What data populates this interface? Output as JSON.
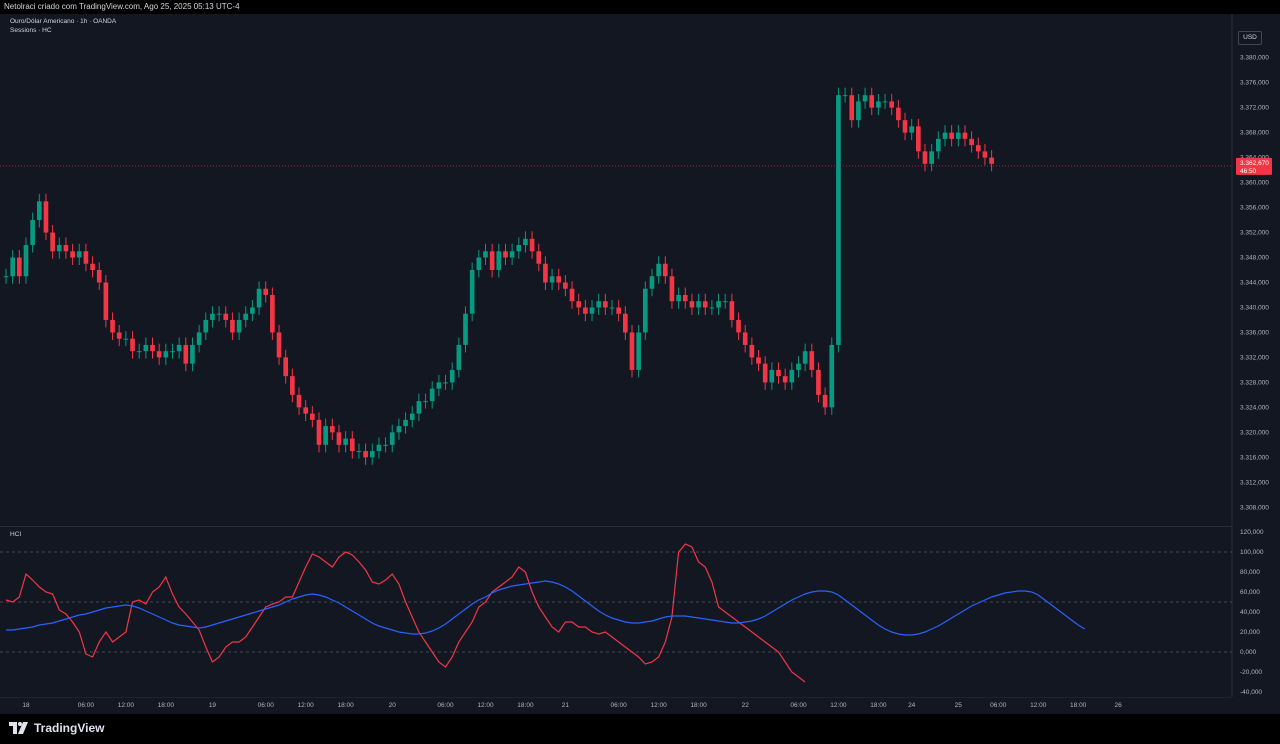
{
  "header": {
    "caption": "Netolraci criado com TradingView.com, Ago 25, 2025 05:13 UTC-4"
  },
  "legend": {
    "symbol": "Ouro/Dólar Americano · 1h · OANDA",
    "indicator": "Sessions · HC",
    "pane2_title": "HCI"
  },
  "currency_button": "USD",
  "current_price": {
    "value": "3.362,670",
    "countdown": "46:50",
    "color": "#f23645"
  },
  "colors": {
    "up": "#089981",
    "down": "#f23645",
    "background": "#131722",
    "line_blue": "#2962ff",
    "line_red": "#f23645",
    "line_green": "#4caf50",
    "line_purple": "#9c27b0"
  },
  "footer": {
    "brand": "TradingView"
  },
  "chart_data": [
    {
      "type": "candlestick",
      "title": "Ouro/Dólar Americano · 1h · OANDA",
      "ylim": [
        3305,
        3387
      ],
      "y_ticks": [
        "3.380,000",
        "3.376,000",
        "3.372,000",
        "3.368,000",
        "3.364,000",
        "3.360,000",
        "3.356,000",
        "3.352,000",
        "3.348,000",
        "3.344,000",
        "3.340,000",
        "3.336,000",
        "3.332,000",
        "3.328,000",
        "3.324,000",
        "3.320,000",
        "3.316,000",
        "3.312,000",
        "3.308,000"
      ],
      "y_tick_values": [
        3380,
        3376,
        3372,
        3368,
        3364,
        3360,
        3356,
        3352,
        3348,
        3344,
        3340,
        3336,
        3332,
        3328,
        3324,
        3320,
        3316,
        3312,
        3308
      ],
      "x_ticks": [
        "18",
        "06:00",
        "12:00",
        "18:00",
        "19",
        "06:00",
        "12:00",
        "18:00",
        "20",
        "06:00",
        "12:00",
        "18:00",
        "21",
        "06:00",
        "12:00",
        "18:00",
        "22",
        "06:00",
        "12:00",
        "18:00",
        "24",
        "25",
        "06:00",
        "12:00",
        "18:00",
        "26"
      ],
      "x_tick_index": [
        3,
        12,
        18,
        24,
        31,
        39,
        45,
        51,
        58,
        66,
        72,
        78,
        84,
        92,
        98,
        104,
        111,
        119,
        125,
        131,
        136,
        143,
        149,
        155,
        161,
        167
      ],
      "closes": [
        3345,
        3348,
        3345,
        3350,
        3354,
        3357,
        3352,
        3349,
        3350,
        3349,
        3348,
        3349,
        3347,
        3346,
        3344,
        3338,
        3336,
        3335,
        3335,
        3333,
        3333,
        3334,
        3333,
        3332,
        3333,
        3333,
        3334,
        3331,
        3334,
        3336,
        3338,
        3339,
        3339,
        3338,
        3336,
        3338,
        3339,
        3340,
        3343,
        3342,
        3336,
        3332,
        3329,
        3326,
        3324,
        3323,
        3322,
        3318,
        3321,
        3320,
        3318,
        3319,
        3317,
        3317,
        3316,
        3317,
        3318,
        3318,
        3320,
        3321,
        3322,
        3323,
        3325,
        3325,
        3327,
        3328,
        3328,
        3330,
        3334,
        3339,
        3346,
        3348,
        3349,
        3346,
        3349,
        3348,
        3349,
        3350,
        3351,
        3349,
        3347,
        3344,
        3345,
        3344,
        3343,
        3341,
        3340,
        3339,
        3340,
        3341,
        3340,
        3340,
        3339,
        3336,
        3330,
        3336,
        3343,
        3345,
        3347,
        3345,
        3341,
        3342,
        3341,
        3340,
        3341,
        3340,
        3340,
        3341,
        3341,
        3338,
        3336,
        3334,
        3332,
        3331,
        3328,
        3330,
        3329,
        3328,
        3330,
        3331,
        3333,
        3330,
        3326,
        3324,
        3334,
        3374,
        3374,
        3370,
        3373,
        3374,
        3372,
        3373,
        3373,
        3372,
        3370,
        3368,
        3369,
        3365,
        3363,
        3365,
        3367,
        3368,
        3367,
        3368,
        3367,
        3366,
        3365,
        3364,
        3363
      ]
    },
    {
      "type": "line",
      "title": "HCI",
      "ylim": [
        -45,
        125
      ],
      "y_ticks": [
        "120,000",
        "100,000",
        "80,000",
        "60,000",
        "40,000",
        "20,000",
        "0,000",
        "-20,000",
        "-40,000"
      ],
      "y_tick_values": [
        120,
        100,
        80,
        60,
        40,
        20,
        0,
        -20,
        -40
      ],
      "levels": [
        100,
        50,
        0
      ],
      "series": [
        {
          "values": [
            52,
            50,
            55,
            78,
            72,
            65,
            60,
            58,
            42,
            38,
            30,
            20,
            -2,
            -5,
            10,
            20,
            10,
            15,
            20,
            50,
            52,
            48,
            60,
            65,
            75,
            58,
            45,
            38,
            30,
            22,
            5,
            -10,
            -5,
            5,
            10,
            10,
            15,
            25,
            35,
            45,
            48,
            50,
            55,
            55,
            70,
            85,
            98,
            95,
            90,
            85,
            95,
            100,
            97,
            90,
            82,
            70,
            68,
            72,
            78,
            68,
            50,
            35,
            20,
            10,
            0,
            -10,
            -15,
            -5,
            10,
            20,
            30,
            45,
            50,
            60,
            65,
            70,
            75,
            85,
            80,
            60,
            45,
            35,
            25,
            20,
            30,
            30,
            25,
            25,
            20,
            18,
            20,
            15,
            10,
            5,
            0,
            -5,
            -12,
            -10,
            -5,
            10,
            35,
            100,
            108,
            105,
            90,
            85,
            70,
            45,
            40,
            35,
            30,
            25,
            20,
            15,
            10,
            5,
            0,
            -10,
            -20,
            -25,
            -30
          ]
        },
        {
          "values": [
            22,
            22,
            23,
            24,
            25,
            27,
            28,
            29,
            31,
            33,
            35,
            37,
            38,
            40,
            42,
            44,
            45,
            46,
            47,
            46,
            44,
            41,
            38,
            35,
            32,
            29,
            27,
            26,
            25,
            24,
            25,
            27,
            29,
            31,
            33,
            35,
            37,
            39,
            41,
            43,
            45,
            47,
            50,
            53,
            55,
            57,
            58,
            57,
            55,
            52,
            49,
            45,
            41,
            37,
            33,
            29,
            26,
            24,
            22,
            20,
            19,
            18,
            18,
            19,
            21,
            24,
            28,
            33,
            38,
            43,
            48,
            52,
            55,
            59,
            62,
            64,
            66,
            67,
            68,
            69,
            70,
            71,
            70,
            68,
            65,
            61,
            56,
            51,
            46,
            41,
            37,
            34,
            32,
            30,
            29,
            29,
            30,
            31,
            33,
            35,
            36,
            36,
            36,
            35,
            34,
            33,
            32,
            31,
            30,
            29,
            29,
            30,
            31,
            33,
            36,
            40,
            44,
            48,
            52,
            55,
            58,
            60,
            61,
            61,
            60,
            57,
            52,
            47,
            42,
            37,
            32,
            27,
            23,
            20,
            18,
            17,
            17,
            18,
            20,
            23,
            26,
            30,
            34,
            38,
            42,
            46,
            49,
            52,
            55,
            57,
            59,
            60,
            61,
            61,
            60,
            57,
            52,
            47,
            42,
            37,
            32,
            27,
            23
          ]
        }
      ]
    }
  ]
}
